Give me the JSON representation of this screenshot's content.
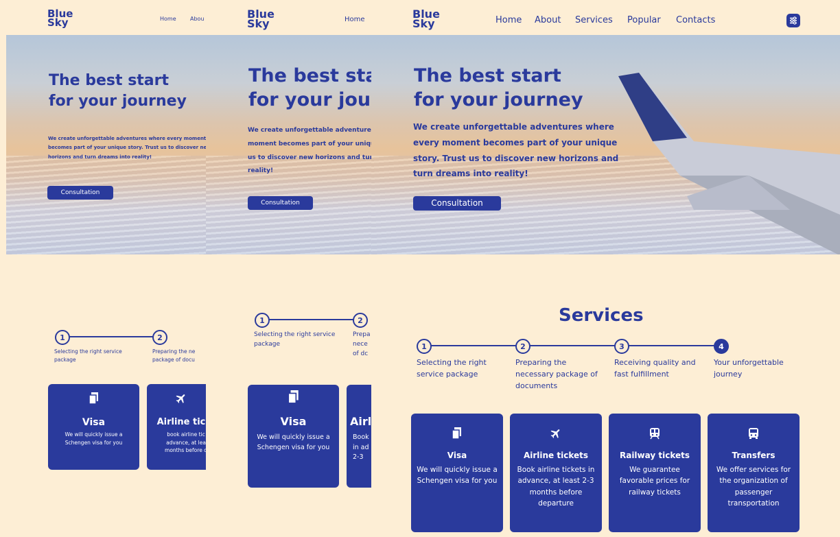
{
  "brand": {
    "logo_line1": "Blue",
    "logo_line2": "Sky"
  },
  "nav": {
    "home": "Home",
    "about": "About",
    "about_short": "Abou",
    "services": "Services",
    "popular": "Popular",
    "contacts": "Contacts",
    "menu_icon": "sliders-icon"
  },
  "hero": {
    "title": "The best start\nfor your journey",
    "text": "We create unforgettable adventures where every moment becomes part of your unique story. Trust us to discover new horizons and turn dreams into reality!",
    "button": "Consultation"
  },
  "services": {
    "title": "Services",
    "steps": [
      {
        "num": "1",
        "label": "Selecting the right service package"
      },
      {
        "num": "2",
        "label": "Preparing the necessary package of documents"
      },
      {
        "num": "3",
        "label": "Receiving quality and fast fulfillment"
      },
      {
        "num": "4",
        "label": "Your unforgettable journey"
      }
    ],
    "p1_step2_label": "Preparing the ne package of docu",
    "p2_step2_label": "Prepa nece of dc",
    "cards": [
      {
        "icon": "documents-icon",
        "title": "Visa",
        "text": "We will quickly issue a Schengen visa for you"
      },
      {
        "icon": "airplane-icon",
        "title": "Airline tickets",
        "text": "Book airline tickets in advance, at least 2-3 months before departure"
      },
      {
        "icon": "train-icon",
        "title": "Railway tickets",
        "text": "We guarantee favorable prices for railway tickets"
      },
      {
        "icon": "bus-icon",
        "title": "Transfers",
        "text": "We offer services for the organization of passenger transportation"
      }
    ],
    "p1_card2": {
      "title": "Airline tic",
      "text": "book airline tic advance, at lea months before d"
    },
    "p2_card2": {
      "title": "Airl",
      "text": "Book in ad 2-3"
    },
    "colors": {
      "primary": "#2a3a9c",
      "background": "#fdeed5"
    }
  }
}
